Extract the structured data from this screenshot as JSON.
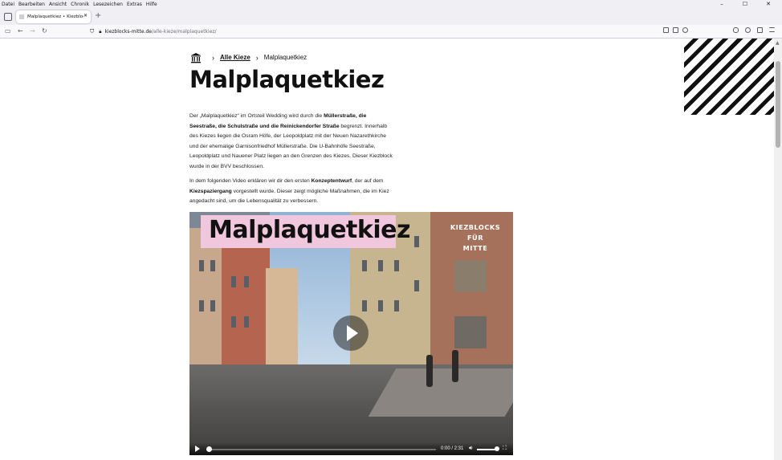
{
  "menu": [
    "Datei",
    "Bearbeiten",
    "Ansicht",
    "Chronik",
    "Lesezeichen",
    "Extras",
    "Hilfe"
  ],
  "window_controls": {
    "minimize": "–",
    "maximize": "☐",
    "close": "✕"
  },
  "tab": {
    "title": "Malplaquetkiez • Kiezblocks für",
    "close": "✕"
  },
  "newtab_label": "+",
  "nav": {
    "back": "←",
    "forward": "→",
    "reload": "↻"
  },
  "url": {
    "host": "kiezblocks-mitte.de",
    "path": "/alle-kieze/malplaquetkiez/"
  },
  "breadcrumb": {
    "sep1": "›",
    "link": "Alle Kieze",
    "sep2": "›",
    "current": "Malplaquetkiez"
  },
  "page_title": "Malplaquetkiez",
  "intro": {
    "t1": "Der „Malplaquetkiez“ im Ortsteil Wedding wird durch die ",
    "b1": "Müllerstraße, die Seestraße, die Schulstraße und die Reinickendorfer Straße",
    "t2": " begrenzt. Innerhalb des Kiezes liegen die Osram Höfe, der Leopoldplatz mit der Neuen Nazarethkirche und der ehemalige Garnisonfriedhof Müllerstraße. Die U-Bahnhöfe Seestraße, Leopoldplatz und Nauener Platz liegen an den Grenzen des Kiezes. Dieser Kiezblock wurde in der BVV beschlossen."
  },
  "video_intro": {
    "t1": "In dem folgenden Video erklären wir dir den ersten ",
    "b1": "Konzeptentwurf",
    "t2": ", der auf dem ",
    "b2": "Kiezspaziergang",
    "t3": " vorgestellt wurde. Dieser zeigt mögliche Maßnahmen, die im Kiez angedacht sind, um die Lebensqualität zu verbessern."
  },
  "video": {
    "title": "Malplaquetkiez",
    "brand_line1": "KIEZBLOCKS",
    "brand_line2": "FÜR",
    "brand_line3": "MITTE",
    "time": "0:00 / 2:31",
    "progress": 0.0,
    "volume": 0.95
  },
  "colors": {
    "video_title_bg": "#f1c7dd",
    "text": "#111111"
  }
}
